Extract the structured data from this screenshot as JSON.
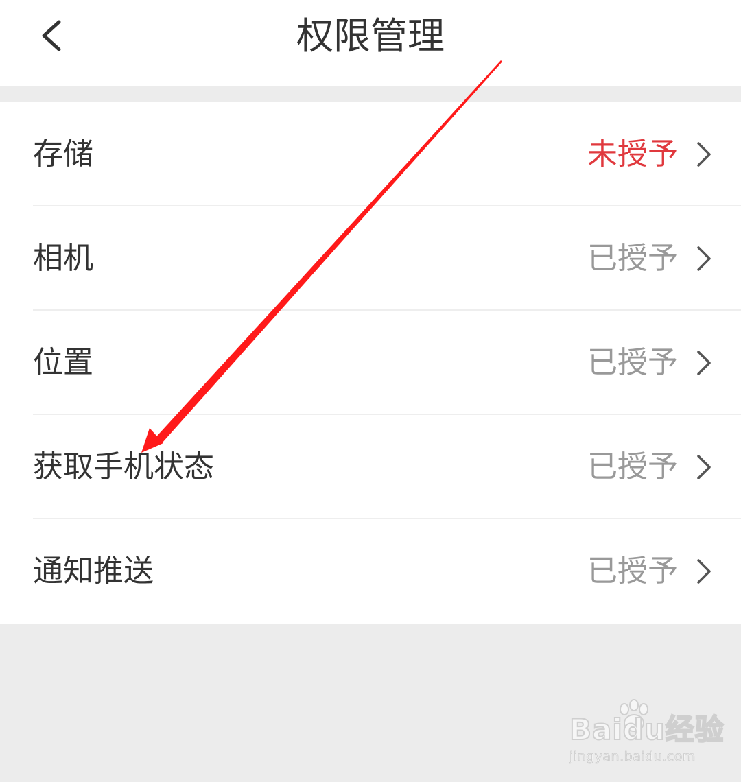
{
  "header": {
    "title": "权限管理",
    "back_icon": "chevron-left-icon"
  },
  "permissions": [
    {
      "label": "存储",
      "status": "未授予",
      "granted": false
    },
    {
      "label": "相机",
      "status": "已授予",
      "granted": true
    },
    {
      "label": "位置",
      "status": "已授予",
      "granted": true
    },
    {
      "label": "获取手机状态",
      "status": "已授予",
      "granted": true
    },
    {
      "label": "通知推送",
      "status": "已授予",
      "granted": true
    }
  ],
  "colors": {
    "denied": "#e0393e",
    "granted": "#999999",
    "annotation_arrow": "#ff1a1a"
  },
  "watermark": {
    "logo": "Baidu经验",
    "url": "jingyan.baidu.com"
  }
}
